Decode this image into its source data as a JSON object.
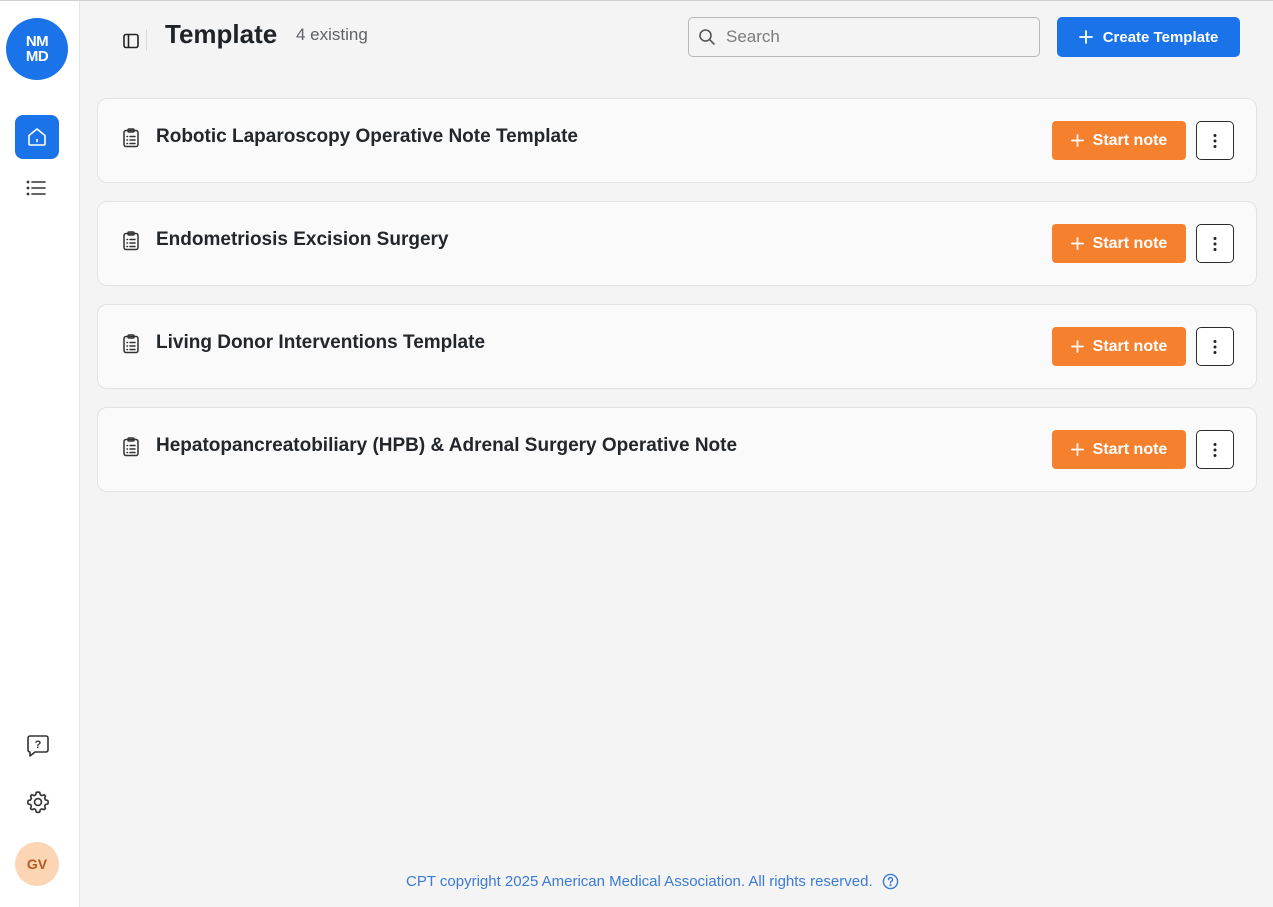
{
  "sidebar": {
    "logo_text": "NMMD",
    "nav_items": [
      {
        "icon": "home-icon",
        "active": true
      },
      {
        "icon": "list-icon",
        "active": false
      }
    ],
    "bottom_items": [
      {
        "icon": "help-chat-icon"
      },
      {
        "icon": "gear-icon"
      }
    ],
    "avatar_initials": "GV"
  },
  "header": {
    "title": "Template",
    "count_label": "4 existing",
    "search_placeholder": "Search",
    "create_label": "Create Template"
  },
  "templates": [
    {
      "title": "Robotic Laparoscopy Operative Note Template",
      "start_label": "Start note"
    },
    {
      "title": "Endometriosis Excision Surgery",
      "start_label": "Start note"
    },
    {
      "title": "Living Donor Interventions Template",
      "start_label": "Start note"
    },
    {
      "title": "Hepatopancreatobiliary (HPB) & Adrenal Surgery Operative Note",
      "start_label": "Start note"
    }
  ],
  "footer": {
    "text": "CPT copyright 2025 American Medical Association. All rights reserved."
  },
  "colors": {
    "primary": "#1a73e8",
    "accent_orange": "#f5802d",
    "avatar_bg": "#fcd5b5",
    "background": "#f4f4f4"
  }
}
